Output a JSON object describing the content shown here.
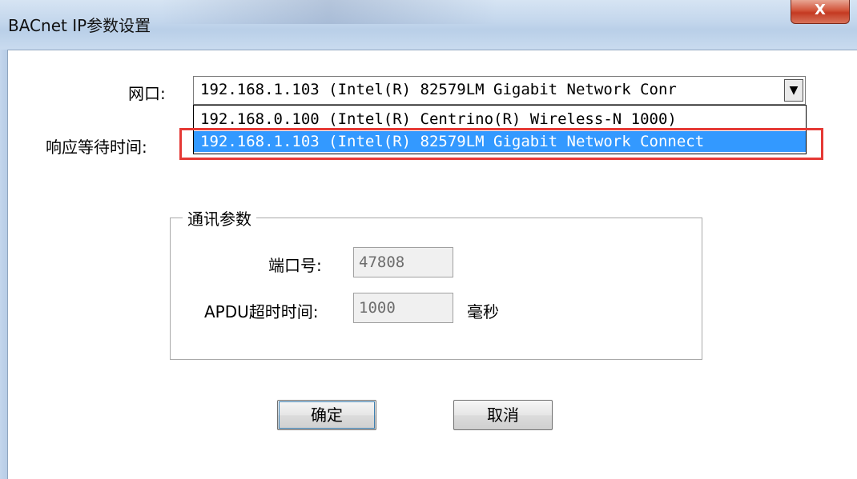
{
  "window": {
    "title": "BACnet IP参数设置",
    "close_label": "X"
  },
  "network": {
    "label": "网口:",
    "selected_value": "192.168.1.103 (Intel(R) 82579LM Gigabit Network Conr",
    "options": [
      "192.168.0.100 (Intel(R) Centrino(R) Wireless-N 1000)",
      "192.168.1.103 (Intel(R) 82579LM Gigabit Network Connect"
    ],
    "highlighted_index": 1
  },
  "timeout": {
    "label": "响应等待时间:"
  },
  "comm": {
    "group_title": "通讯参数",
    "port_label": "端口号:",
    "port_value": "47808",
    "apdu_label": "APDU超时时间:",
    "apdu_value": "1000",
    "apdu_unit": "毫秒"
  },
  "buttons": {
    "ok_label": "确定",
    "cancel_label": "取消"
  },
  "colors": {
    "highlight_bg": "#3399ff",
    "annotation_border": "#e53935"
  }
}
